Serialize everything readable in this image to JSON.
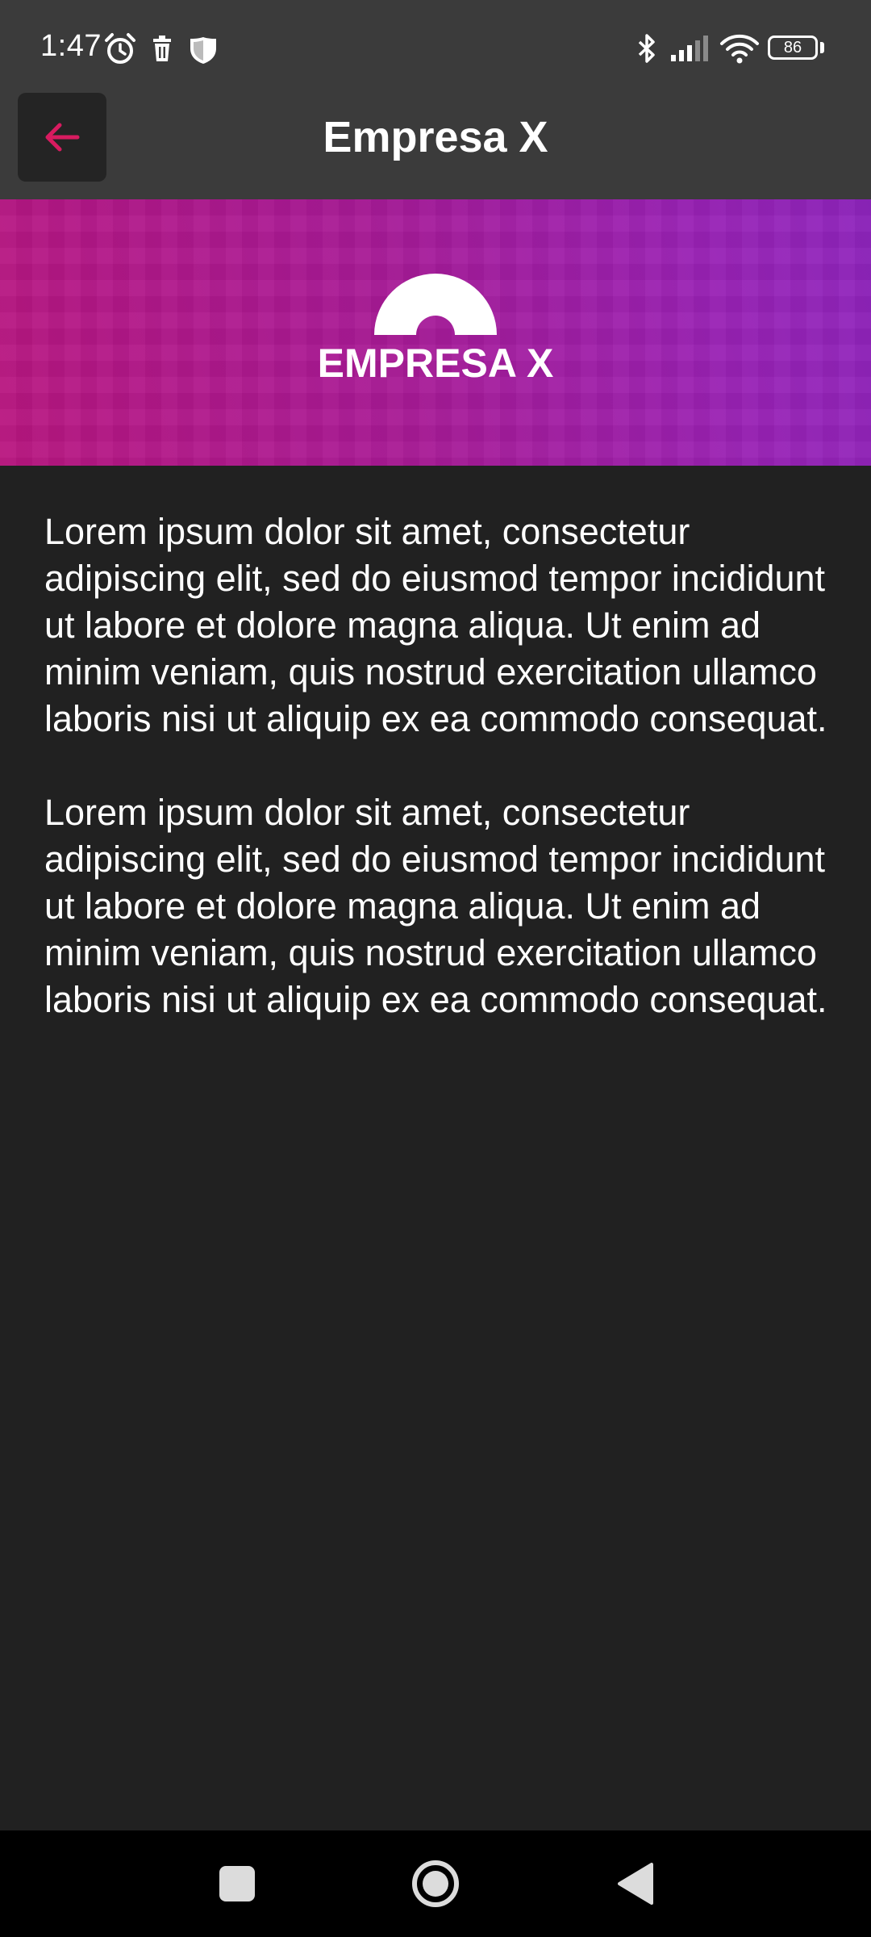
{
  "status_bar": {
    "time": "1:47",
    "battery_level": "86",
    "icons_left": [
      "alarm-icon",
      "delete-icon",
      "shield-icon"
    ],
    "icons_right": [
      "bluetooth-icon",
      "signal-icon",
      "wifi-icon",
      "battery-icon"
    ]
  },
  "app_bar": {
    "title": "Empresa X",
    "back_icon": "arrow-left-icon",
    "accent_color": "#d81b60"
  },
  "banner": {
    "logo_text": "EMPRESA X",
    "gradient_colors": [
      "#b8177f",
      "#9a22b4"
    ]
  },
  "content": {
    "paragraphs": [
      "Lorem ipsum dolor sit amet, consectetur adipiscing elit, sed do eiusmod tempor incididunt ut labore et dolore magna aliqua. Ut enim ad minim veniam, quis nostrud exercitation ullamco laboris nisi ut aliquip ex ea commodo consequat.",
      "Lorem ipsum dolor sit amet, consectetur adipiscing elit, sed do eiusmod tempor incididunt ut labore et dolore magna aliqua. Ut enim ad minim veniam, quis nostrud exercitation ullamco laboris nisi ut aliquip ex ea commodo consequat."
    ]
  },
  "nav_bar": {
    "buttons": [
      "recents-icon",
      "home-icon",
      "back-icon"
    ]
  }
}
